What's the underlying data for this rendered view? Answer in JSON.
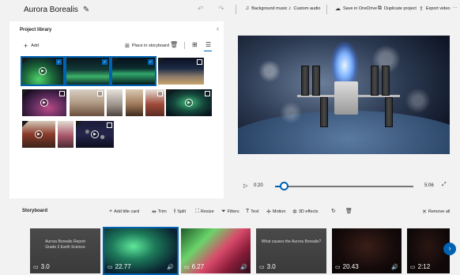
{
  "app": {
    "title": "Aurora Borealis"
  },
  "toolbar": {
    "undo_icon": "↶",
    "redo_icon": "↷",
    "background_music": "Background music",
    "custom_audio": "Custom audio",
    "save_onedrive": "Save in OneDrive",
    "duplicate_project": "Duplicate project",
    "export_video": "Export video",
    "more": "···"
  },
  "library": {
    "title": "Project library",
    "add_label": "Add",
    "place_label": "Place in storyboard"
  },
  "playback": {
    "current_time": "0:20",
    "total_time": "5:06",
    "progress": 0.06
  },
  "storyboard": {
    "title": "Storyboard",
    "add_title_card": "Add title card",
    "trim": "Trim",
    "split": "Split",
    "resize": "Resize",
    "filters": "Filters",
    "text": "Text",
    "motion": "Motion",
    "effects_3d": "3D effects",
    "remove_all": "Remove all",
    "cards": [
      {
        "text_line1": "Aurora Borealis Report",
        "text_line2": "Grade 3 Earth Science",
        "duration": "3.0"
      },
      {
        "duration": "22.77"
      },
      {
        "duration": "6.27"
      },
      {
        "text_line1": "What causes the Aurora Borealis?",
        "duration": "3.0"
      },
      {
        "duration": "20.43"
      },
      {
        "duration": "2:12"
      }
    ]
  },
  "colors": {
    "accent": "#0063b1",
    "panel": "#ffffff",
    "background": "#f2f2f2"
  }
}
